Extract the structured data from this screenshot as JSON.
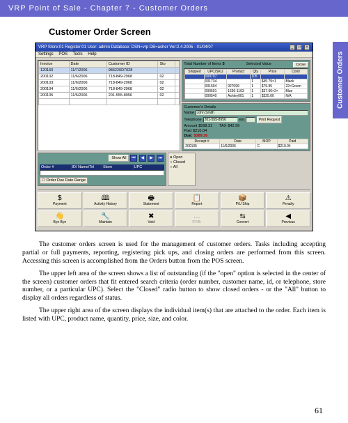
{
  "header": "VRP Point of Sale - Chapter 7 - Customer Orders",
  "side_tab": "Customer Orders",
  "section_title": "Customer Order Screen",
  "titlebar": "VRP Store:01 Register:01 User: admin Database: DSN=vrp DB=asher Ver:2.4.2005 - 01/04/07",
  "menu": {
    "m0": "Settings",
    "m1": "POS",
    "m2": "Tools",
    "m3": "Help"
  },
  "orders": {
    "cols": {
      "c0": "Invoice",
      "c1": "Date",
      "c2": "Customer ID",
      "c3": "Sto"
    },
    "rows": [
      {
        "c0": "120160",
        "c1": "11/7/2006",
        "c2": "986220D7028",
        "c3": ""
      },
      {
        "c0": "200102",
        "c1": "11/6/2006",
        "c2": "718-849-2968",
        "c3": "02"
      },
      {
        "c0": "200103",
        "c1": "11/6/2006",
        "c2": "718-849-2968",
        "c3": "02"
      },
      {
        "c0": "200104",
        "c1": "11/6/2006",
        "c2": "718-849-2968",
        "c3": "02"
      },
      {
        "c0": "200105",
        "c1": "11/6/2006",
        "c2": "201-555-8956",
        "c3": "02"
      }
    ]
  },
  "items": {
    "total_label": "Total Number of Items",
    "total_value": "5",
    "selected_label": "Selected Value",
    "close": "Close",
    "cols": {
      "c0": "Shipped",
      "c1": "UPC/SKU",
      "c2": "Product",
      "c3": "Qty",
      "c4": "Price",
      "c5": "Color"
    },
    "rows": [
      {
        "c0": "",
        "c1": "000707",
        "c2": "",
        "c3": "105",
        "c4": "",
        "c5": ""
      },
      {
        "c0": "",
        "c1": "001734",
        "c2": "",
        "c3": "1",
        "c4": "$45.79×1",
        "c5": "Black"
      },
      {
        "c0": "",
        "c1": "001594",
        "c2": "927099",
        "c3": "1",
        "c4": "$79.95",
        "c5": "22×Green"
      },
      {
        "c0": "",
        "c1": "000501",
        "c2": "1636-1103",
        "c3": "1",
        "c4": "$37.60×2×",
        "c5": "Blue"
      },
      {
        "c0": "",
        "c1": "000540",
        "c2": "Ashley001",
        "c3": "1",
        "c4": "$325.00",
        "c5": "N/A"
      }
    ]
  },
  "details": {
    "header": "Customer's Details",
    "name_label": "Name",
    "name_value": "John Smith",
    "tel_label": "Telephone",
    "tel_value": "201-555-8956",
    "ext_label": "ext",
    "ext_value": "",
    "amount_label": "Amount",
    "amount_value": "$598.31",
    "tax_label": "TAX",
    "tax_value": "$42.99",
    "paid_label": "Paid",
    "paid_value": "$210.04",
    "due_label": "Due:",
    "due_value": "$389.26",
    "print": "Print Request"
  },
  "receipt": {
    "cols": {
      "c0": "Receipt #",
      "c1": "Date",
      "c2": "MOP",
      "c3": "Paid"
    },
    "row": {
      "c0": "200105",
      "c1": "11/6/2006",
      "c2": "C",
      "c3": "$210.04"
    }
  },
  "search": {
    "show_all": "Show All",
    "cols": {
      "c0": "Order #",
      "c1": "ID/ Name/Tel",
      "c2": "Store",
      "c3": "UPC"
    }
  },
  "radio": {
    "open": "Open",
    "closed": "Closed",
    "all": "All"
  },
  "date_range": "Order Due Date Range",
  "buttons": {
    "r0": {
      "b0": "Payment",
      "b1": "Activity History",
      "b2": "Statement",
      "b3": "Report",
      "b4": "P/U Ship",
      "b5": "Penalty"
    },
    "r1": {
      "b0": "Bye Bye",
      "b1": "Maintain",
      "b2": "Void",
      "b3": "P.P.B.",
      "b4": "Convert",
      "b5": "Previous"
    }
  },
  "icons": {
    "payment": "$",
    "history": "🕮",
    "statement": "🖶",
    "report": "📋",
    "puship": "📦",
    "penalty": "⚠",
    "byebye": "👋",
    "maintain": "🔧",
    "void": "✖",
    "ppb": "…",
    "convert": "⇆",
    "previous": "◀"
  },
  "paragraphs": {
    "p0": "The customer orders screen is used for the management of customer orders.  Tasks including accepting partial or full payments, reporting, registering pick ups, and closing orders are performed from this screen.  Accessing this screen is accomplished from the Orders button from the POS screen.",
    "p1": "The upper left area of the screen shows a list of outstanding (if the \"open\" option is selected in the center of the screen) customer orders that fit entered search criteria (order number, customer name, id, or telephone, store number, or a particular UPC).  Select the \"Closed\" radio button to show closed orders - or the \"All\" button to display all orders regardless of status.",
    "p2": "The upper right area of the screen displays the individual item(s) that are attached to the order.  Each item is listed with UPC, product name, quantity, price, size, and color."
  },
  "page_number": "61"
}
